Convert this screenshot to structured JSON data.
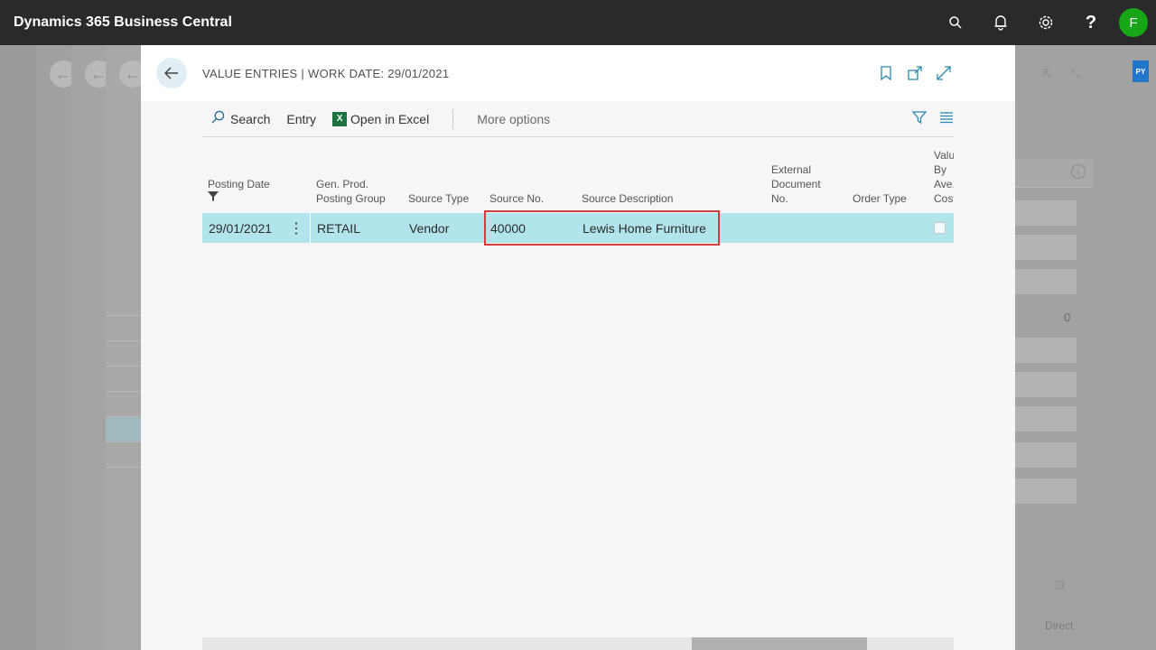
{
  "app": {
    "title": "Dynamics 365 Business Central",
    "avatar_initial": "F"
  },
  "icons": {
    "search": "search-icon",
    "bell": "bell-icon",
    "settings": "gear-icon",
    "help": "help-icon"
  },
  "right_panel": {
    "badge": "PY",
    "value": "0",
    "label": "Direct"
  },
  "modal": {
    "title": "VALUE ENTRIES | WORK DATE: 29/01/2021",
    "toolbar": {
      "search": "Search",
      "entry": "Entry",
      "excel_badge": "X",
      "open_excel": "Open in Excel",
      "more_options": "More options"
    },
    "columns": {
      "posting_date": "Posting Date",
      "gen_prod_l1": "Gen. Prod.",
      "gen_prod_l2": "Posting Group",
      "source_type": "Source Type",
      "source_no": "Source No.",
      "source_description": "Source Description",
      "ext_doc_l1": "External",
      "ext_doc_l2": "Document",
      "ext_doc_l3": "No.",
      "order_type": "Order Type",
      "val_avg_l1": "Valu",
      "val_avg_l2": "By",
      "val_avg_l3": "Ave.",
      "val_avg_l4": "Cost"
    },
    "row": {
      "posting_date": "29/01/2021",
      "gen_prod_posting_group": "RETAIL",
      "source_type": "Vendor",
      "source_no": "40000",
      "source_description": "Lewis Home Furniture",
      "external_document_no": "",
      "order_type": ""
    }
  },
  "colors": {
    "selection": "#b2e5eb",
    "accent": "#2a8ab0",
    "highlight_box": "#d63a3a",
    "appbar": "#2a2a2a"
  }
}
